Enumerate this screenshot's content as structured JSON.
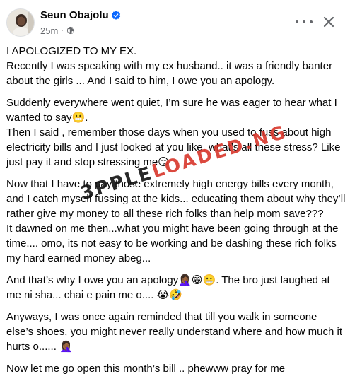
{
  "author": {
    "name": "Seun Obajolu",
    "time": "25m",
    "separator": "·"
  },
  "icons": {
    "verified": "verified-badge-icon",
    "audience": "globe-icon",
    "more": "more-options-icon",
    "close": "close-icon"
  },
  "colors": {
    "verified_blue": "#0866ff",
    "meta_gray": "#65676b",
    "text": "#050505"
  },
  "post": {
    "paragraphs": [
      "I APOLOGIZED TO MY EX.\nRecently I was speaking with my ex husband.. it was a friendly banter about the girls ... And I said to him, I owe you an apology.",
      "Suddenly everywhere went quiet, I’m sure he was eager to hear what I wanted to say😬.\nThen I said , remember those days when you used to fuss about high electricity bills and I just looked at you like,  what’s all these stress? Like just pay it and stop stressing me😏",
      "Now that I have to pay those extremely high energy bills every month, and I catch myself fussing at the kids... educating them about why they’ll rather give my money to all these rich folks than help mom save???\nIt dawned on me then...what you might have been going through at the time.... omo, its not easy to be working and be dashing these rich folks my hard earned money abeg...",
      "And that’s why I owe you an apology🤦🏾‍♀️😁😬. The bro just laughed at me ni sha... chai e pain me o.... 😭🤣",
      "Anyways,  I was once again reminded that till you walk in someone else’s shoes, you might never really understand where and how much it hurts o...... 🤦🏾‍♀️",
      "Now let me go open this month’s bill .. phewww pray for me"
    ]
  },
  "watermark": {
    "part1": "3PPLE",
    "part2": "LOADED",
    "part3": ".NG"
  }
}
